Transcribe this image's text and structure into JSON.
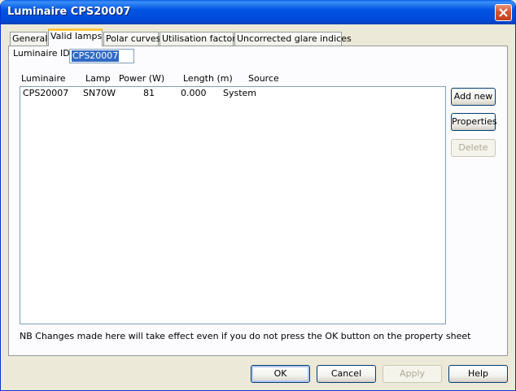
{
  "window": {
    "title": "Luminaire CPS20007"
  },
  "tabs": [
    {
      "label": "General"
    },
    {
      "label": "Valid lamps"
    },
    {
      "label": "Polar curves"
    },
    {
      "label": "Utilisation factors"
    },
    {
      "label": "Uncorrected glare indices"
    }
  ],
  "active_tab": "Valid lamps",
  "luminaire_id": {
    "label": "Luminaire ID",
    "value": "CPS20007"
  },
  "table": {
    "columns": [
      "Luminaire",
      "Lamp",
      "Power (W)",
      "Length (m)",
      "Source"
    ],
    "rows": [
      [
        "CPS20007",
        "SN70W",
        "81",
        "0.000",
        "System"
      ]
    ]
  },
  "side_buttons": {
    "add_new": "Add new",
    "properties": "Properties",
    "delete": "Delete"
  },
  "note": "NB Changes made here will take effect even if you do not press the OK button on the property sheet",
  "dialog_buttons": {
    "ok": "OK",
    "cancel": "Cancel",
    "apply": "Apply",
    "help": "Help"
  },
  "colors": {
    "titlebar": "#0054e3",
    "selection": "#316ac5",
    "tab_highlight": "#ffc83c"
  }
}
